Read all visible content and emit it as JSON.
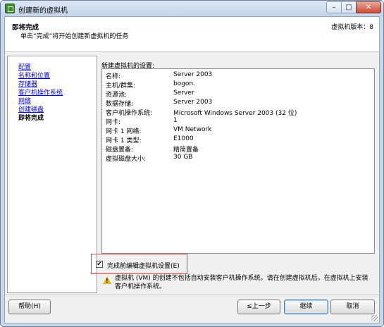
{
  "window": {
    "title": "创建新的虚拟机",
    "controls": {
      "minimize": "–",
      "maximize": "□",
      "close": "✕"
    }
  },
  "header": {
    "title": "即将完成",
    "subtitle": "单击“完成”将开始创建新虚拟机的任务",
    "version": "虚拟机版本：8"
  },
  "nav": {
    "items": [
      {
        "label": "配置",
        "current": false
      },
      {
        "label": "名称和位置",
        "current": false
      },
      {
        "label": "存储器",
        "current": false
      },
      {
        "label": "客户机操作系统",
        "current": false
      },
      {
        "label": "网络",
        "current": false
      },
      {
        "label": "创建磁盘",
        "current": false
      },
      {
        "label": "即将完成",
        "current": true
      }
    ]
  },
  "settings": {
    "label": "新建虚拟机的设置:",
    "rows": [
      {
        "key": "名称:",
        "value": "Server 2003"
      },
      {
        "key": "主机/群集:",
        "value": "bogon."
      },
      {
        "key": "资源池:",
        "value": "Server"
      },
      {
        "key": "数据存储:",
        "value": "Server 2003"
      },
      {
        "key": "客户机操作系统:",
        "value": "Microsoft Windows Server 2003 (32 位)"
      },
      {
        "key": "网卡:",
        "value": "1"
      },
      {
        "key": "网卡 1 网络:",
        "value": "VM Network"
      },
      {
        "key": "网卡 1 类型:",
        "value": "E1000"
      },
      {
        "key": "磁盘置备:",
        "value": "精简置备"
      },
      {
        "key": "虚拟磁盘大小:",
        "value": "30 GB"
      }
    ]
  },
  "edit_option": {
    "label": "完成前编辑虚拟机设置(E)",
    "checked": true,
    "check_glyph": "✔"
  },
  "warning": {
    "icon_glyph": "!",
    "text": "虚拟机 (VM) 的创建不包括自动安装客户机操作系统。请在创建虚拟机后，在虚拟机上安装客户机操作系统。"
  },
  "buttons": {
    "help": "帮助(H)",
    "back": "≤上一步",
    "next": "继续",
    "cancel": "取消"
  }
}
